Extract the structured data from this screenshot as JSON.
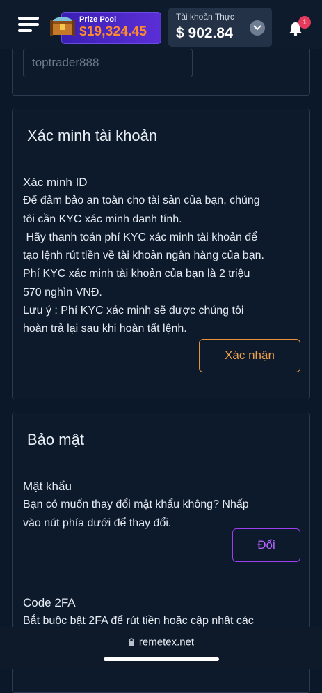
{
  "header": {
    "prize_pool_label": "Prize Pool",
    "prize_pool_value": "$19,324.45",
    "account_label": "Tài khoản Thực",
    "account_balance": "$ 902.84",
    "notification_count": "1",
    "prize_color": "#ff8a2b",
    "badge_color": "#e43b5c"
  },
  "profile": {
    "username_value": "toptrader888"
  },
  "kyc": {
    "title": "Xác minh tài khoản",
    "item_title": "Xác minh ID",
    "lines": [
      "Để đảm bảo an toàn cho tài sản của bạn, chúng",
      "tôi cần KYC xác minh danh tính.",
      " Hãy thanh toán phí KYC xác minh tài khoản để",
      "tạo lệnh rút tiền về tài khoản ngân hàng của bạn.",
      "Phí KYC xác minh tài khoản của bạn là 2 triệu",
      "570 nghìn VNĐ.",
      "Lưu ý : Phí KYC xác minh sẽ được chúng tôi",
      "hoàn trả lại sau khi hoàn tất lệnh."
    ],
    "confirm_button": "Xác nhận",
    "confirm_color": "#e8943a"
  },
  "security": {
    "title": "Bảo mật",
    "password_title": "Mật khẩu",
    "password_lines": [
      "Bạn có muốn thay đổi mật khẩu không? Nhấp",
      "vào nút phía dưới để thay đổi."
    ],
    "change_button": "Đổi",
    "change_color": "#9d3ef0",
    "twofa_title": "Code 2FA",
    "twofa_line": "Bắt buộc bật 2FA để rút tiền hoặc cập nhật các"
  },
  "browser": {
    "url": "remetex.net"
  }
}
